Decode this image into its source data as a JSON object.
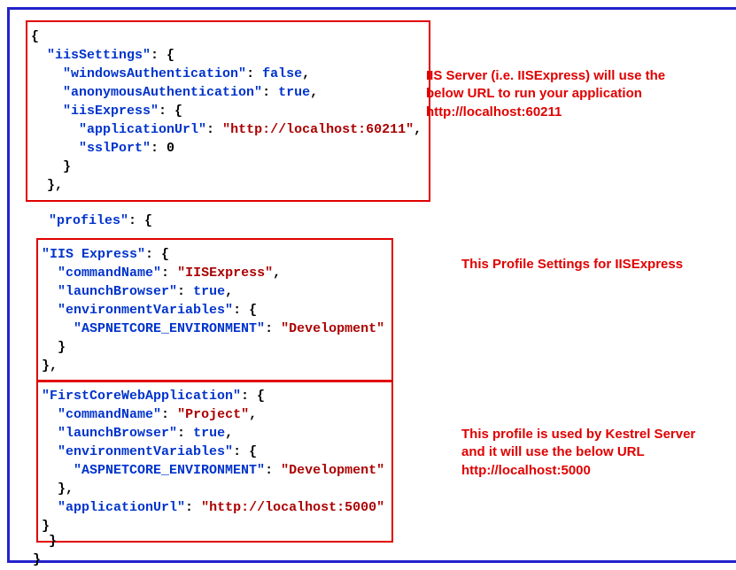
{
  "box1": {
    "l1": "{",
    "k_iisSettings": "\"iisSettings\"",
    "k_windowsAuth": "\"windowsAuthentication\"",
    "v_false": "false",
    "k_anonAuth": "\"anonymousAuthentication\"",
    "v_true": "true",
    "k_iisExpress": "\"iisExpress\"",
    "k_appUrl": "\"applicationUrl\"",
    "v_url1": "\"http://localhost:60211\"",
    "k_sslPort": "\"sslPort\"",
    "v_zero": "0",
    "annot_l1": "IIS Server (i.e. IISExpress) will use the",
    "annot_l2": "below URL to run your application",
    "annot_l3": "http://localhost:60211"
  },
  "profilesKey": "\"profiles\"",
  "box2": {
    "k_iisExpress": "\"IIS Express\"",
    "k_cmdName": "\"commandName\"",
    "v_iisExpress": "\"IISExpress\"",
    "k_launchBrowser": "\"launchBrowser\"",
    "v_true": "true",
    "k_envVars": "\"environmentVariables\"",
    "k_aspnetcore": "\"ASPNETCORE_ENVIRONMENT\"",
    "v_dev": "\"Development\"",
    "annot": "This Profile Settings for IISExpress"
  },
  "box3": {
    "k_first": "\"FirstCoreWebApplication\"",
    "k_cmdName": "\"commandName\"",
    "v_project": "\"Project\"",
    "k_launchBrowser": "\"launchBrowser\"",
    "v_true": "true",
    "k_envVars": "\"environmentVariables\"",
    "k_aspnetcore": "\"ASPNETCORE_ENVIRONMENT\"",
    "v_dev": "\"Development\"",
    "k_appUrl": "\"applicationUrl\"",
    "v_url2": "\"http://localhost:5000\"",
    "annot_l1": "This profile is used by Kestrel Server",
    "annot_l2": "and it will use the below URL",
    "annot_l3": "http://localhost:5000"
  },
  "closeBrace1": "}",
  "closeBrace2": "}"
}
